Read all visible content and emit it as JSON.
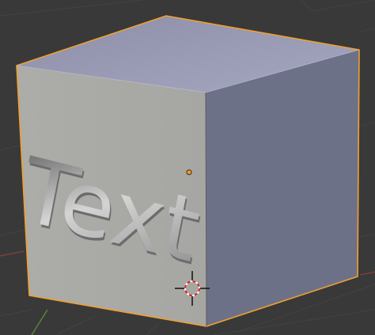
{
  "viewport": {
    "background": "#393939",
    "grid_color": "#434343",
    "axis_x_color": "#8a3c3c",
    "axis_y_color": "#5a8a3a"
  },
  "cube": {
    "front_face_color": "#a9a9a5",
    "side_face_color": "#6d7188",
    "top_face_color": "#9a9bb6",
    "outline_color": "#f0a030",
    "embossed_text": "Text",
    "selected": true
  },
  "origin_dot": {
    "color": "#f29a2c",
    "icon": "object-origin-dot"
  },
  "cursor_3d": {
    "icon": "3d-cursor-icon",
    "ring_colors": [
      "#d02020",
      "#ffffff"
    ]
  }
}
